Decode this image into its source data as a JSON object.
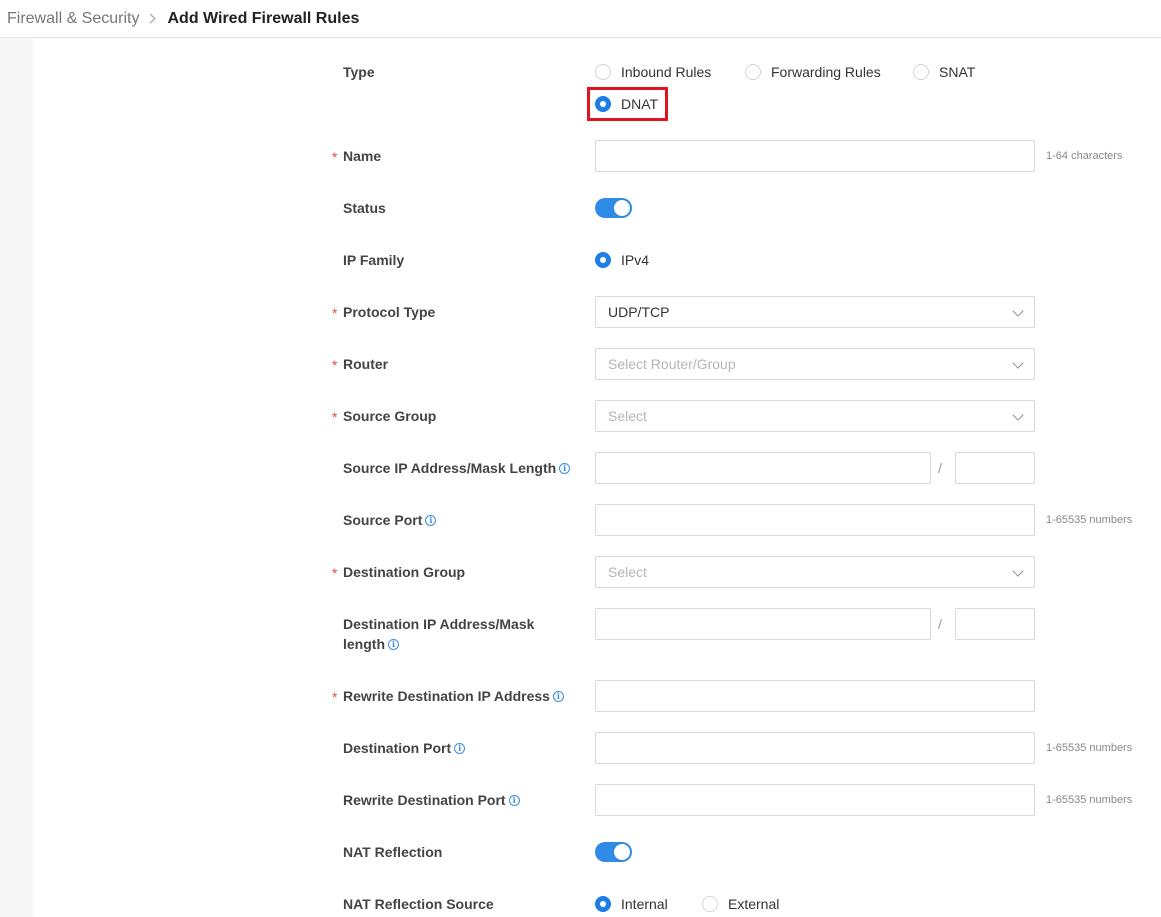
{
  "breadcrumb": {
    "parent": "Firewall & Security",
    "current": "Add Wired Firewall Rules"
  },
  "form": {
    "type": {
      "label": "Type",
      "options": [
        "Inbound Rules",
        "Forwarding Rules",
        "SNAT",
        "DNAT"
      ],
      "selected": "DNAT"
    },
    "name": {
      "label": "Name",
      "value": "",
      "hint": "1-64 characters"
    },
    "status": {
      "label": "Status",
      "enabled": true
    },
    "ip_family": {
      "label": "IP Family",
      "option": "IPv4"
    },
    "protocol_type": {
      "label": "Protocol Type",
      "value": "UDP/TCP"
    },
    "router": {
      "label": "Router",
      "placeholder": "Select Router/Group"
    },
    "source_group": {
      "label": "Source Group",
      "placeholder": "Select"
    },
    "source_ip": {
      "label": "Source IP Address/Mask Length",
      "separator": "/"
    },
    "source_port": {
      "label": "Source Port",
      "hint": "1-65535 numbers"
    },
    "destination_group": {
      "label": "Destination Group",
      "placeholder": "Select"
    },
    "destination_ip": {
      "label_line1": "Destination IP Address/Mask",
      "label_line2": "length",
      "separator": "/"
    },
    "rewrite_destination_ip": {
      "label": "Rewrite Destination IP Address"
    },
    "destination_port": {
      "label": "Destination Port",
      "hint": "1-65535 numbers"
    },
    "rewrite_destination_port": {
      "label": "Rewrite Destination Port",
      "hint": "1-65535 numbers"
    },
    "nat_reflection": {
      "label": "NAT Reflection",
      "enabled": true
    },
    "nat_reflection_source": {
      "label": "NAT Reflection Source",
      "options": [
        "Internal",
        "External"
      ],
      "selected": "Internal"
    }
  },
  "colors": {
    "accent": "#1e7ee6",
    "highlight": "#e0141e",
    "required": "#e54545"
  }
}
